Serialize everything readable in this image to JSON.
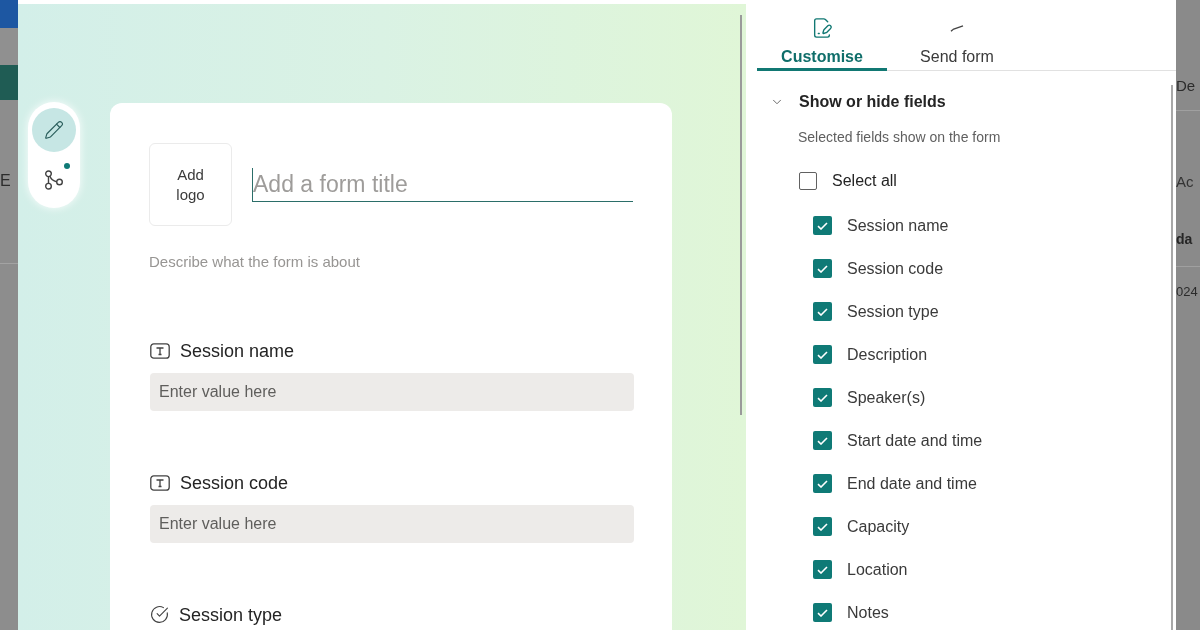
{
  "background_page": {
    "left_texts": [
      "E"
    ],
    "right_texts": [
      "De",
      "Ac",
      "da",
      "024"
    ]
  },
  "tool_rail": [
    {
      "kind": "edit",
      "selected": true,
      "notification": false
    },
    {
      "kind": "branching",
      "selected": false,
      "notification": true
    }
  ],
  "form": {
    "logo_button": "Add logo",
    "title": {
      "placeholder": "Add a form title"
    },
    "description": {
      "placeholder": "Describe what the form is about"
    },
    "fields": [
      {
        "kind": "text",
        "label": "Session name",
        "placeholder": "Enter value here"
      },
      {
        "kind": "text",
        "label": "Session code",
        "placeholder": "Enter value here"
      },
      {
        "kind": "choice",
        "label": "Session type"
      }
    ]
  },
  "panel": {
    "tabs": [
      {
        "kind": "customise",
        "label": "Customise",
        "selected": true
      },
      {
        "kind": "send",
        "label": "Send form",
        "selected": false
      }
    ],
    "section": {
      "title": "Show or hide fields",
      "expanded": true,
      "hint": "Selected fields show on the form",
      "select_all": {
        "label": "Select all",
        "checked": false
      },
      "fields": [
        {
          "label": "Session name",
          "checked": true
        },
        {
          "label": "Session code",
          "checked": true
        },
        {
          "label": "Session type",
          "checked": true
        },
        {
          "label": "Description",
          "checked": true
        },
        {
          "label": "Speaker(s)",
          "checked": true
        },
        {
          "label": "Start date and time",
          "checked": true
        },
        {
          "label": "End date and time",
          "checked": true
        },
        {
          "label": "Capacity",
          "checked": true
        },
        {
          "label": "Location",
          "checked": true
        },
        {
          "label": "Notes",
          "checked": true
        }
      ]
    }
  }
}
